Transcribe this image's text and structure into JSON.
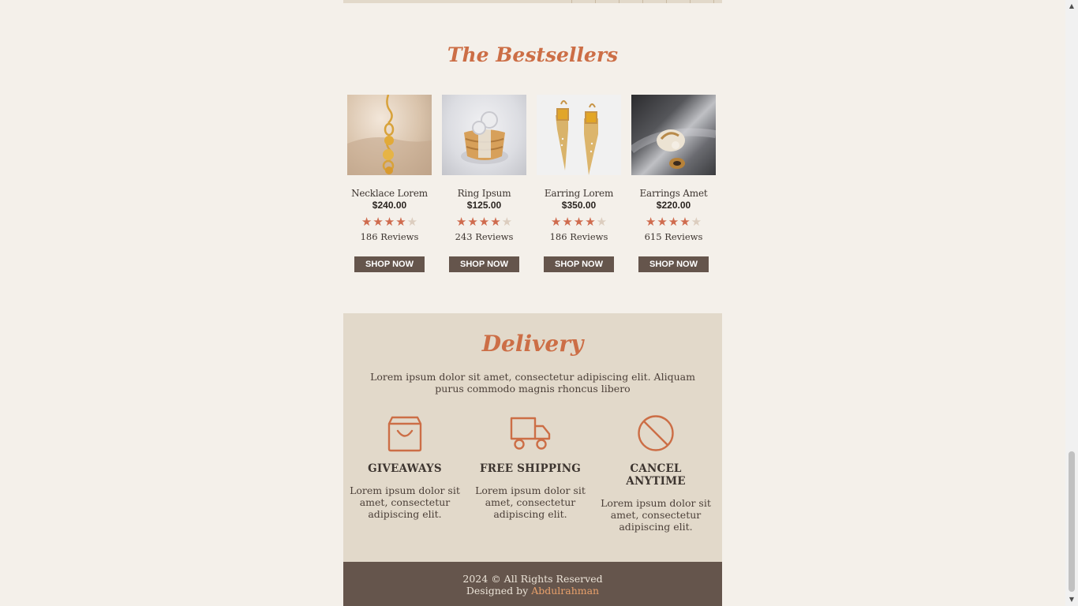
{
  "bestsellers": {
    "title": "The Bestsellers",
    "products": [
      {
        "name": "Necklace Lorem",
        "price": "$240.00",
        "rating": 4,
        "max_rating": 5,
        "reviews": "186 Reviews",
        "cta": "SHOP NOW"
      },
      {
        "name": "Ring Ipsum",
        "price": "$125.00",
        "rating": 4,
        "max_rating": 5,
        "reviews": "243 Reviews",
        "cta": "SHOP NOW"
      },
      {
        "name": "Earring Lorem",
        "price": "$350.00",
        "rating": 4,
        "max_rating": 5,
        "reviews": "186 Reviews",
        "cta": "SHOP NOW"
      },
      {
        "name": "Earrings Amet",
        "price": "$220.00",
        "rating": 4,
        "max_rating": 5,
        "reviews": "615 Reviews",
        "cta": "SHOP NOW"
      }
    ]
  },
  "delivery": {
    "title": "Delivery",
    "text": "Lorem ipsum dolor sit amet, consectetur adipiscing elit. Aliquam purus commodo magnis rhoncus libero",
    "features": [
      {
        "icon": "shopping-bag-icon",
        "title": "GIVEAWAYS",
        "text": "Lorem ipsum dolor sit amet, consectetur adipiscing elit."
      },
      {
        "icon": "truck-icon",
        "title": "FREE SHIPPING",
        "text": "Lorem ipsum dolor sit amet, consectetur adipiscing elit."
      },
      {
        "icon": "prohibited-icon",
        "title": "CANCEL ANYTIME",
        "text": "Lorem ipsum dolor sit amet, consectetur adipiscing elit."
      }
    ]
  },
  "footer": {
    "copyright": "2024 © All Rights Reserved",
    "designed_prefix": "Designed by",
    "designer": "Abdulrahman"
  },
  "colors": {
    "accent": "#cc6e46",
    "page_bg": "#f4f0ea",
    "delivery_bg": "#e2d9ca",
    "dark": "#65554c",
    "star_on": "#cf6b4e",
    "star_off": "#dccdbf"
  }
}
